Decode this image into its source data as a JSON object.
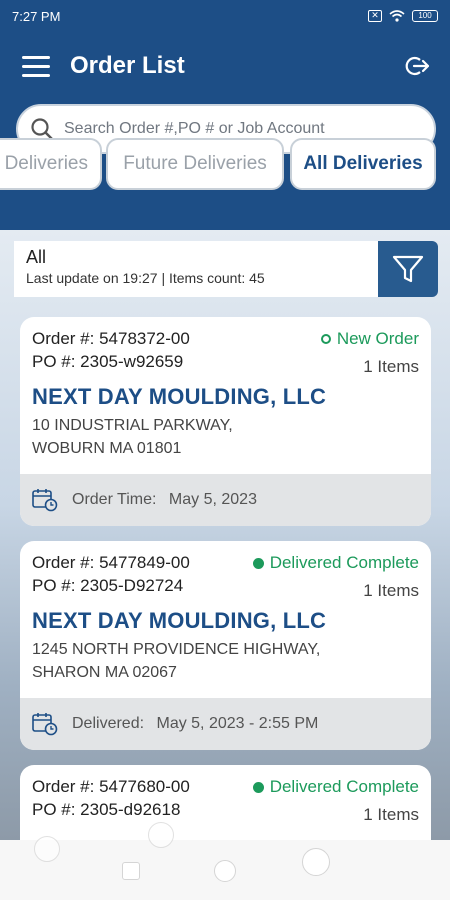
{
  "status_bar": {
    "time": "7:27 PM",
    "battery": "100"
  },
  "header": {
    "title": "Order List"
  },
  "search": {
    "placeholder": "Search Order #,PO # or Job Account"
  },
  "tabs": [
    {
      "label": "Deliveries",
      "active": false
    },
    {
      "label": "Future Deliveries",
      "active": false
    },
    {
      "label": "All Deliveries",
      "active": true
    }
  ],
  "filter": {
    "title": "All",
    "last_update": "Last update on 19:27",
    "items_count": "| Items count: 45"
  },
  "orders": [
    {
      "order": "Order #: 5478372-00",
      "po": "PO #: 2305-w92659",
      "status": "New Order",
      "items": "1 Items",
      "company": "NEXT DAY MOULDING, LLC",
      "address1": "10 INDUSTRIAL PARKWAY,",
      "address2": "WOBURN MA  01801",
      "footer_label": "Order Time:",
      "footer_value": "May 5, 2023"
    },
    {
      "order": "Order #: 5477849-00",
      "po": "PO #: 2305-D92724",
      "status": "Delivered Complete",
      "items": "1 Items",
      "company": "NEXT DAY MOULDING, LLC",
      "address1": "1245 NORTH PROVIDENCE HIGHWAY,",
      "address2": "SHARON MA  02067",
      "footer_label": "Delivered:",
      "footer_value": "May 5, 2023 - 2:55 PM"
    },
    {
      "order": "Order #: 5477680-00",
      "po": "PO #: 2305-d92618",
      "status": "Delivered Complete",
      "items": "1 Items"
    }
  ],
  "colors": {
    "brand": "#1d4e86",
    "status_green": "#1c9a5b"
  }
}
